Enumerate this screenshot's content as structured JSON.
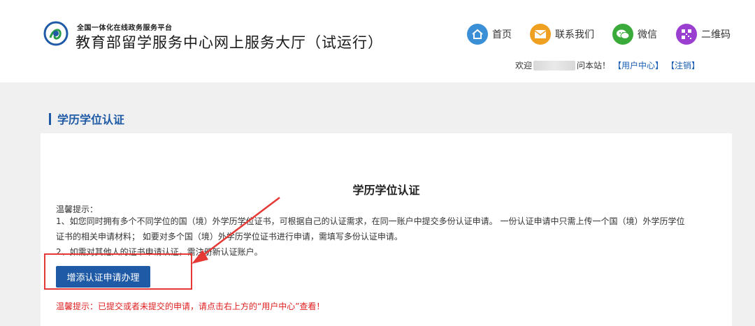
{
  "header": {
    "platform_name": "全国一体化在线政务服务平台",
    "site_title": "教育部留学服务中心网上服务大厅（试运行）",
    "nav": [
      {
        "label": "首页",
        "icon": "home-icon",
        "color": "#3a8fd6"
      },
      {
        "label": "联系我们",
        "icon": "mail-icon",
        "color": "#f0a020"
      },
      {
        "label": "微信",
        "icon": "wechat-icon",
        "color": "#3aab3a"
      },
      {
        "label": "二维码",
        "icon": "qrcode-icon",
        "color": "#9a3fd0"
      }
    ],
    "welcome_prefix": "欢迎",
    "welcome_suffix": "问本站！",
    "user_center": "【用户中心】",
    "logout": "【注销】"
  },
  "section": {
    "title": "学历学位认证"
  },
  "card": {
    "title": "学历学位认证",
    "tip_head": "温馨提示：",
    "tip_lines": [
      "1、如您同时拥有多个不同学位的国（境）外学历学位证书，可根据自己的认证需求，在同一账户中提交多份认证申请。 一份认证申请中只需上传一个国（境）外学历学位",
      "证书的相关申请材料； 如要对多个国（境）外学历学位证书进行申请，需填写多份认证申请。",
      "2、如需对其他人的证书申请认证，需注册新认证账户。"
    ],
    "add_button": "增添认证申请办理",
    "warning": "温馨提示：已提交或者未提交的申请，请点击右上方的“用户中心”查看！"
  },
  "colors": {
    "primary": "#1f5aa6",
    "warning": "#e02020",
    "annotation": "#e53935"
  }
}
